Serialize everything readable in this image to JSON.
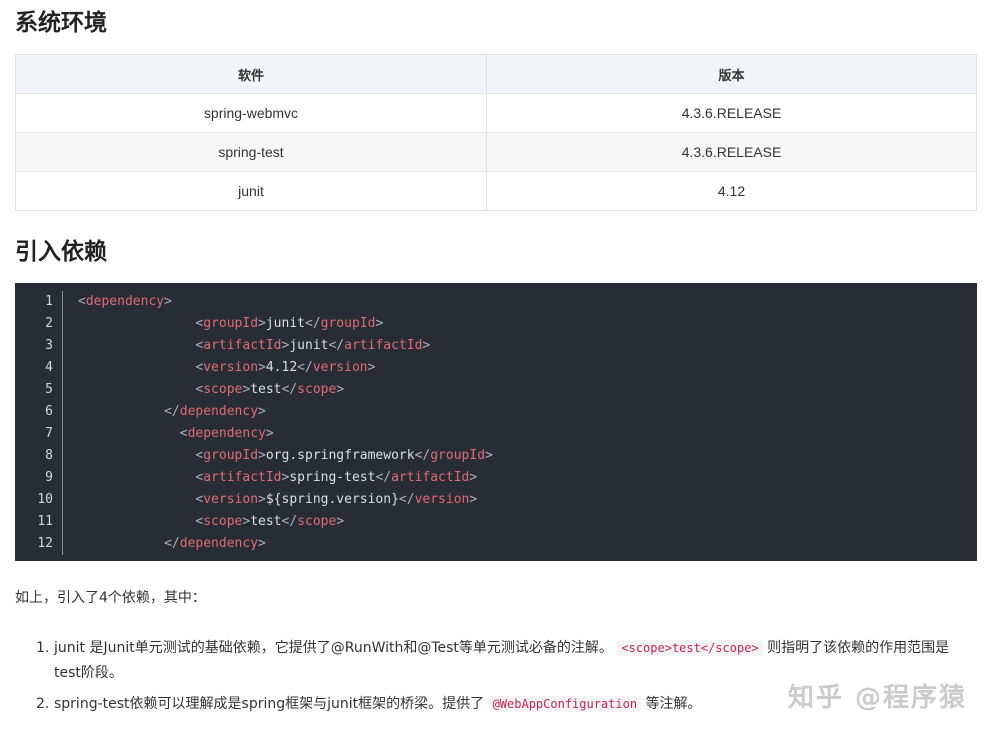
{
  "sections": {
    "env_title": "系统环境",
    "deps_title": "引入依赖"
  },
  "env_table": {
    "headers": [
      "软件",
      "版本"
    ],
    "rows": [
      [
        "spring-webmvc",
        "4.3.6.RELEASE"
      ],
      [
        "spring-test",
        "4.3.6.RELEASE"
      ],
      [
        "junit",
        "4.12"
      ]
    ]
  },
  "code": {
    "line_numbers": [
      "1",
      "2",
      "3",
      "4",
      "5",
      "6",
      "7",
      "8",
      "9",
      "10",
      "11",
      "12"
    ],
    "lines": [
      {
        "indent": "",
        "tag": "dependency",
        "text": "",
        "close": false,
        "open_only": true
      },
      {
        "indent": "               ",
        "tag": "groupId",
        "text": "junit"
      },
      {
        "indent": "               ",
        "tag": "artifactId",
        "text": "junit"
      },
      {
        "indent": "               ",
        "tag": "version",
        "text": "4.12"
      },
      {
        "indent": "               ",
        "tag": "scope",
        "text": "test"
      },
      {
        "indent": "           ",
        "tag": "dependency",
        "close_only": true
      },
      {
        "indent": "             ",
        "tag": "dependency",
        "open_only": true
      },
      {
        "indent": "               ",
        "tag": "groupId",
        "text": "org.springframework"
      },
      {
        "indent": "               ",
        "tag": "artifactId",
        "text": "spring-test"
      },
      {
        "indent": "               ",
        "tag": "version",
        "text": "${spring.version}"
      },
      {
        "indent": "               ",
        "tag": "scope",
        "text": "test"
      },
      {
        "indent": "           ",
        "tag": "dependency",
        "close_only": true
      }
    ]
  },
  "intro": "如上，引入了4个依赖，其中：",
  "notes": [
    {
      "num": "1.",
      "before": "junit 是Junit单元测试的基础依赖，它提供了@RunWith和@Test等单元测试必备的注解。",
      "code": "<scope>test</scope>",
      "after": "则指明了该依赖的作用范围是test阶段。"
    },
    {
      "num": "2.",
      "before": "spring-test依赖可以理解成是spring框架与junit框架的桥梁。提供了",
      "code": "@WebAppConfiguration",
      "after": "等注解。"
    }
  ],
  "watermark": "知乎 @程序猿"
}
